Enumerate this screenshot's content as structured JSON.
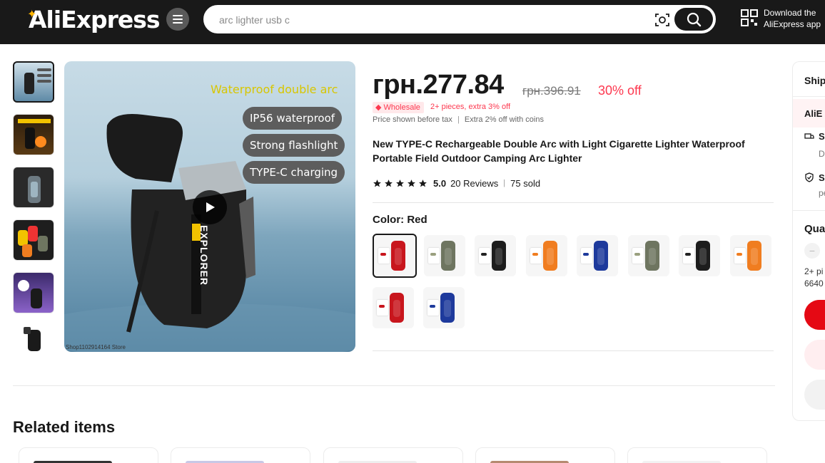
{
  "header": {
    "logo": "AliExpress",
    "search_placeholder": "arc lighter usb c",
    "download_line1": "Download the",
    "download_line2": "AliExpress app"
  },
  "thumbnails": [
    "thumb-1",
    "thumb-2",
    "thumb-3",
    "thumb-4",
    "thumb-5",
    "thumb-6"
  ],
  "main_image": {
    "overlay_title": "Waterproof double arc",
    "features": [
      "IP56 waterproof",
      "Strong flashlight",
      "TYPE-C charging"
    ],
    "store_watermark": "Shop1102914164 Store",
    "brand_on_product": "EXPLORER"
  },
  "product": {
    "price": "грн.277.84",
    "old_price": "грн.396.91",
    "discount": "30% off",
    "wholesale_badge": "Wholesale",
    "wholesale_text": "2+ pieces, extra 3% off",
    "tax_note": "Price shown before tax",
    "coins_note": "Extra 2% off with coins",
    "title": "New TYPE-C Rechargeable Double Arc with Light Cigarette Lighter Waterproof Portable Field Outdoor Camping Arc Lighter",
    "rating": "5.0",
    "reviews": "20 Reviews",
    "sold": "75 sold",
    "color_label": "Color: Red"
  },
  "swatches": [
    {
      "color": "#c8161d",
      "dot": "#c8161d"
    },
    {
      "color": "#6e7560",
      "dot": "#9aa07f"
    },
    {
      "color": "#1d1d1d",
      "dot": "#222222"
    },
    {
      "color": "#f07d20",
      "dot": "#f07d20"
    },
    {
      "color": "#1e3a9c",
      "dot": "#1e3a9c"
    },
    {
      "color": "#6e7560",
      "dot": "#9aa07f"
    },
    {
      "color": "#1d1d1d",
      "dot": "#222222"
    },
    {
      "color": "#f07d20",
      "dot": "#f07d20"
    },
    {
      "color": "#c8161d",
      "dot": "#c8161d"
    },
    {
      "color": "#1e3a9c",
      "dot": "#1e3a9c"
    }
  ],
  "related": {
    "heading": "Related items"
  },
  "right_panel": {
    "ship": "Ship",
    "ali_label": "AliE",
    "row1": "Sh",
    "row1_sub": "D",
    "row2": "Se",
    "row2_sub": "pe",
    "quantity": "Qua",
    "minus": "−",
    "note_line1": "2+ pi",
    "note_line2": "6640"
  },
  "colors": {
    "header_bg": "#191919",
    "accent_red": "#fd384f",
    "buy_button": "#e50914"
  }
}
